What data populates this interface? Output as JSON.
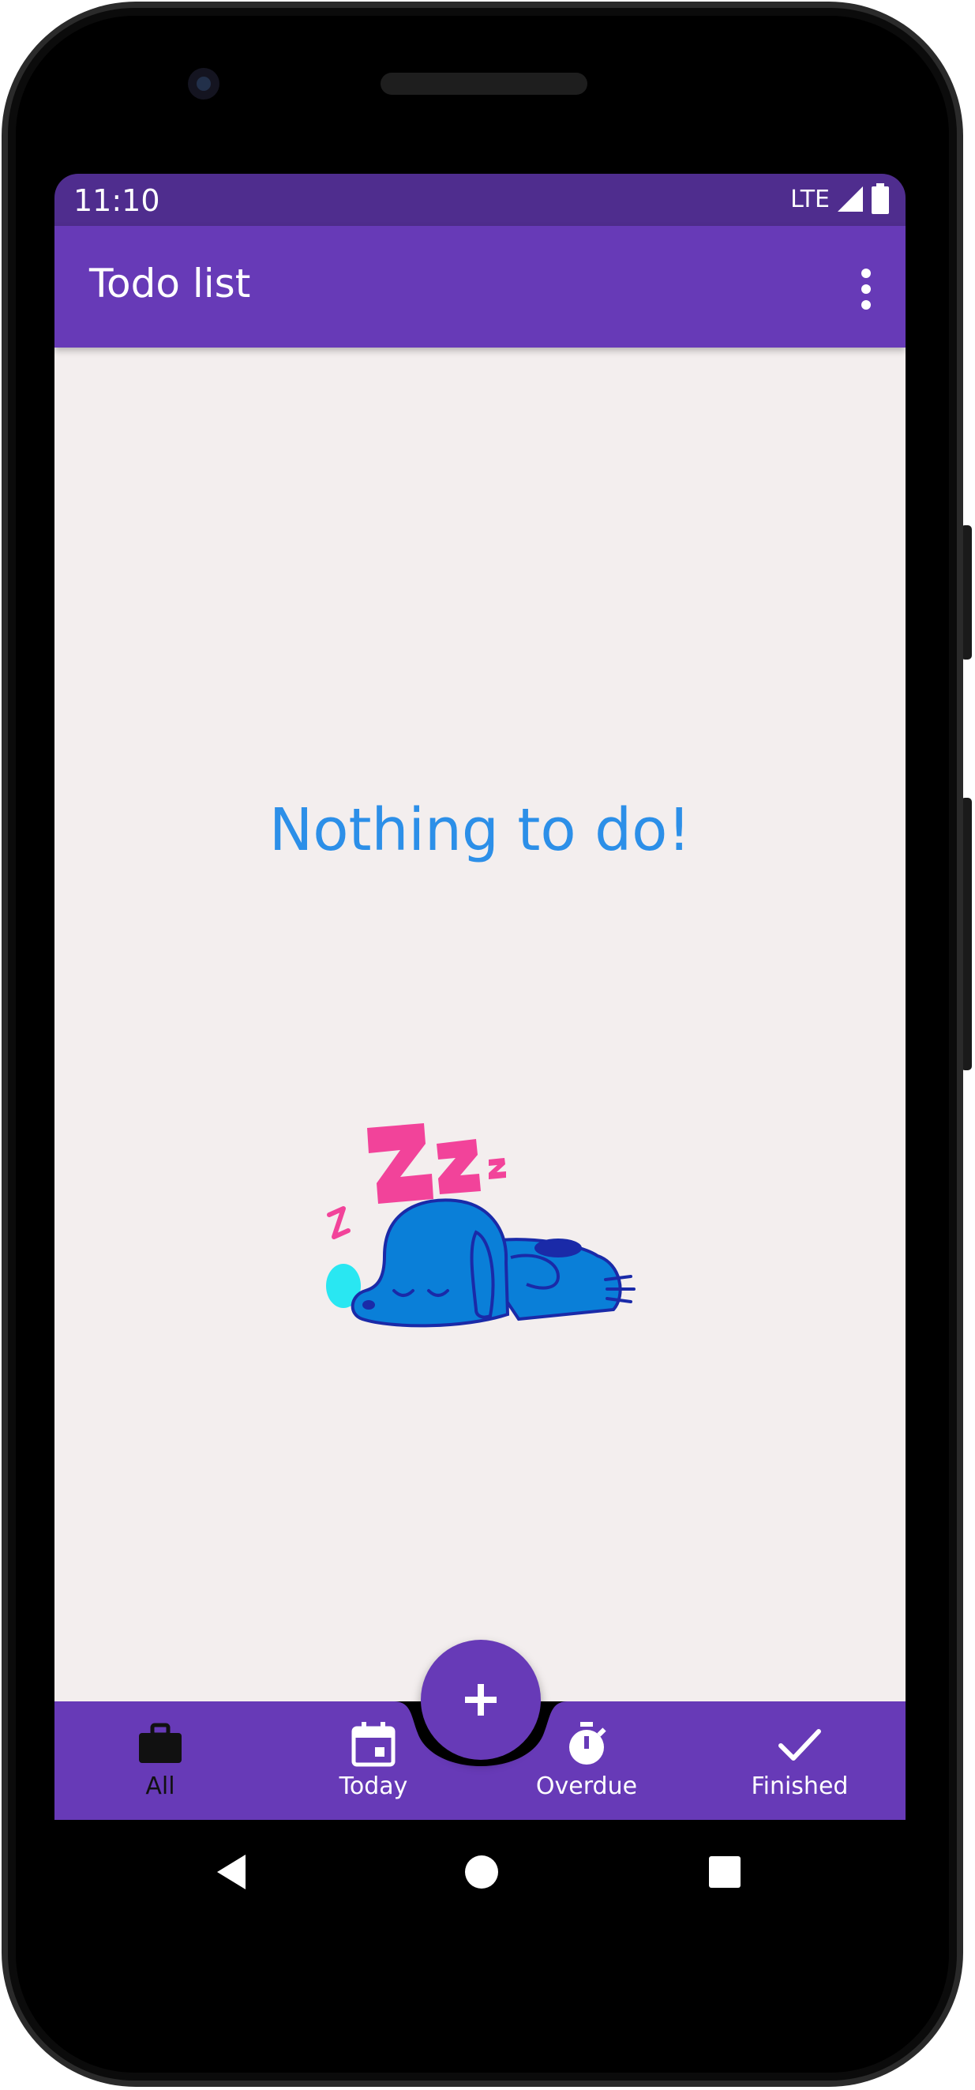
{
  "status_bar": {
    "time": "11:10",
    "network": "LTE",
    "icons": [
      "signal-icon",
      "battery-icon"
    ]
  },
  "app_bar": {
    "title": "Todo list",
    "menu_icon": "more-vert-icon"
  },
  "empty_state": {
    "message": "Nothing to do!",
    "illustration": "sleeping-dog-illustration"
  },
  "fab": {
    "icon": "plus-icon"
  },
  "bottom_nav": {
    "active_index": 0,
    "items": [
      {
        "label": "All",
        "icon": "briefcase-icon"
      },
      {
        "label": "Today",
        "icon": "calendar-icon"
      },
      {
        "label": "Overdue",
        "icon": "timer-icon"
      },
      {
        "label": "Finished",
        "icon": "check-icon"
      }
    ]
  },
  "system_nav": {
    "buttons": [
      "back-icon",
      "home-icon",
      "recents-icon"
    ]
  },
  "colors": {
    "primary": "#673ab7",
    "primary_dark": "#4f2d8e",
    "background": "#f3eeee",
    "accent_text": "#2c8fe8",
    "zzz": "#f2439a",
    "dog": "#0a7fd8"
  }
}
